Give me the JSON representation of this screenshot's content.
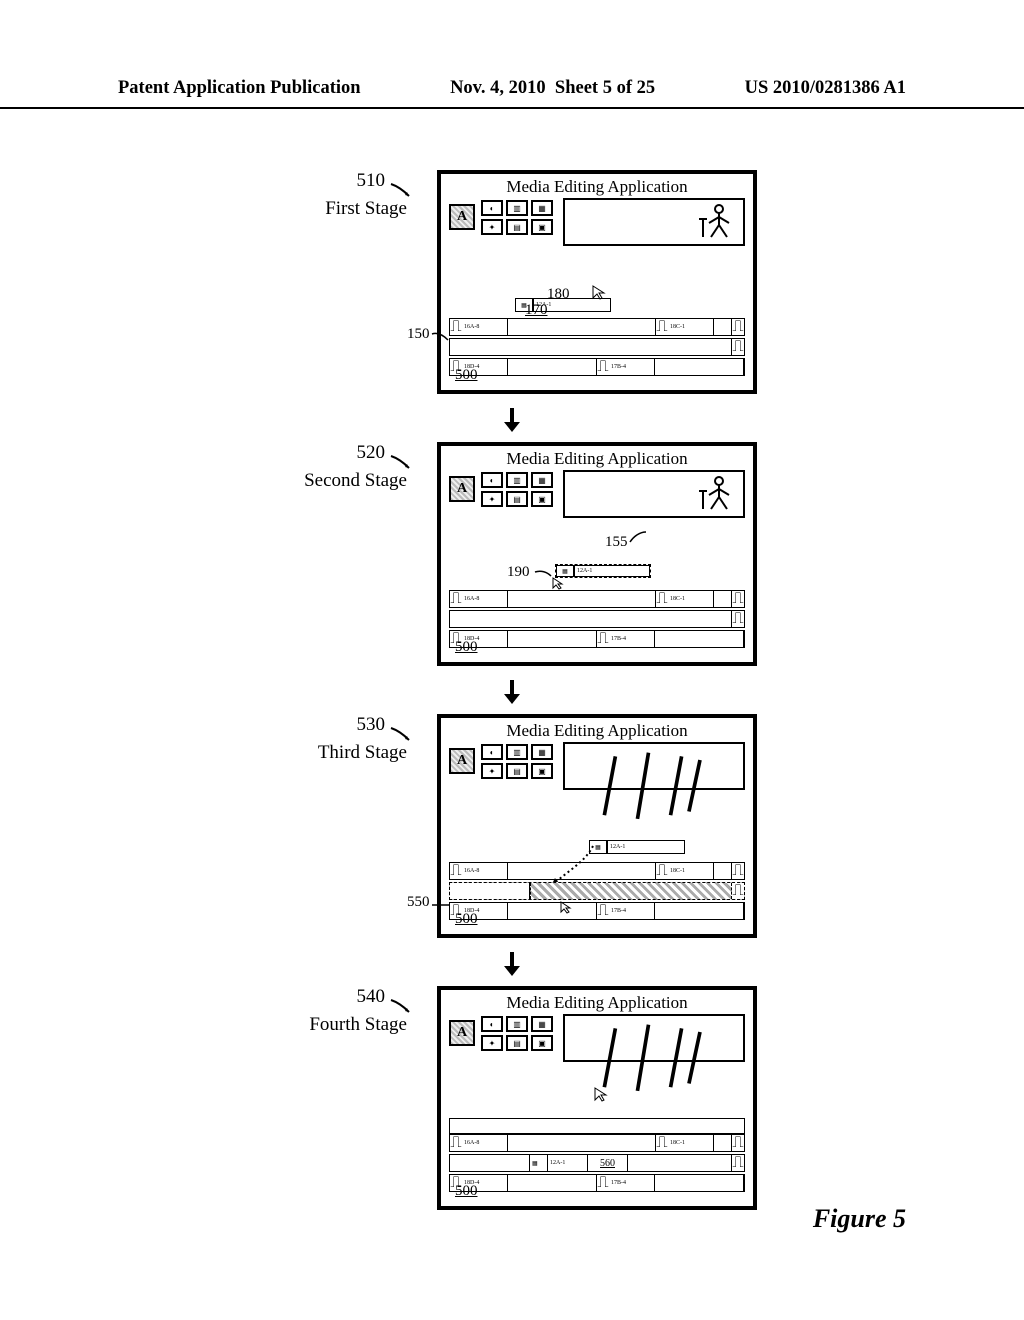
{
  "header": {
    "left": "Patent Application Publication",
    "date": "Nov. 4, 2010",
    "sheet": "Sheet 5 of 25",
    "pubno": "US 2010/0281386 A1"
  },
  "figure_label": "Figure 5",
  "app_title": "Media Editing Application",
  "stages": [
    {
      "num": "510",
      "label": "First Stage"
    },
    {
      "num": "520",
      "label": "Second Stage"
    },
    {
      "num": "530",
      "label": "Third Stage"
    },
    {
      "num": "540",
      "label": "Fourth Stage"
    }
  ],
  "refs": {
    "r150": "150",
    "r155": "155",
    "r170": "170",
    "r180": "180",
    "r190": "190",
    "r500": "500",
    "r550": "550",
    "r560": "560"
  },
  "clip_labels": {
    "top_small": "12A-1",
    "left_a": "16A-8",
    "right_a": "18C-1",
    "left_b": "18D-4",
    "right_b": "17B-4",
    "mid_new": "12A-1"
  },
  "toolbar_letter": "A"
}
